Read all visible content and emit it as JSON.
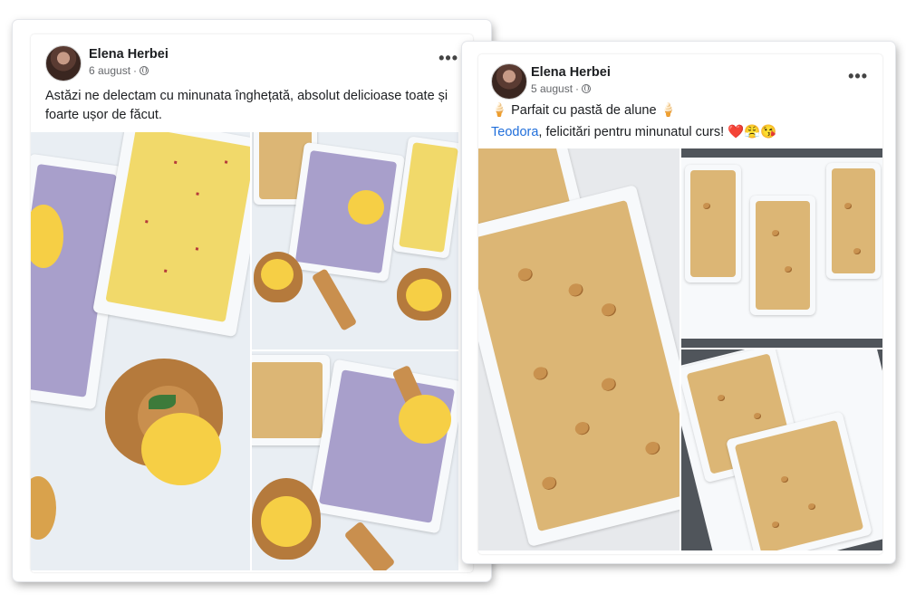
{
  "post1": {
    "author": "Elena Herbei",
    "date": "6 august",
    "separator": "·",
    "text": "Astăzi ne delectam cu minunata înghețată, absolut delicioase toate și foarte ușor de făcut.",
    "avatar_icon": "profile-photo"
  },
  "post2": {
    "author": "Elena Herbei",
    "date": "5 august",
    "separator": "·",
    "title": "Parfait cu pastă de alune",
    "mention": "Teodora",
    "text_after_mention": ", felicitări pentru minunatul curs!",
    "emojis": "❤️😤😘",
    "ice_cream_emoji": "🍦"
  },
  "colors": {
    "link": "#216fdb",
    "text": "#1c1e21",
    "meta": "#65676b"
  }
}
